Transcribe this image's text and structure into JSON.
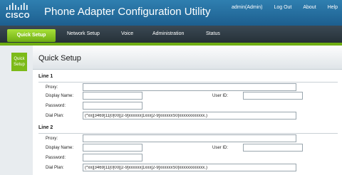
{
  "header": {
    "logo_text": "CISCO",
    "app_title": "Phone Adapter Configuration Utility",
    "links": [
      "admin(Admin)",
      "Log Out",
      "About",
      "Help"
    ]
  },
  "nav": {
    "tabs": [
      "Quick Setup",
      "Network Setup",
      "Voice",
      "Administration",
      "Status"
    ],
    "active": "Quick Setup"
  },
  "sidebar": {
    "items": [
      "Quick Setup"
    ]
  },
  "page": {
    "title": "Quick Setup"
  },
  "lines": [
    {
      "header": "Line 1",
      "proxy_label": "Proxy:",
      "proxy_value": "",
      "display_name_label": "Display Name:",
      "display_name_value": "",
      "user_id_label": "User ID:",
      "user_id_value": "",
      "password_label": "Password:",
      "password_value": "",
      "dial_plan_label": "Dial Plan:",
      "dial_plan_value": "(*xx|[3469]11|0|00|[2-9]xxxxxx|1xxx[2-9]xxxxxxS0|xxxxxxxxxxxx.)"
    },
    {
      "header": "Line 2",
      "proxy_label": "Proxy:",
      "proxy_value": "",
      "display_name_label": "Display Name:",
      "display_name_value": "",
      "user_id_label": "User ID:",
      "user_id_value": "",
      "password_label": "Password:",
      "password_value": "",
      "dial_plan_label": "Dial Plan:",
      "dial_plan_value": "(*xx|[3469]11|0|00|[2-9]xxxxxx|1xxx[2-9]xxxxxxS0|xxxxxxxxxxxx.)"
    }
  ],
  "colors": {
    "header": "#2f7fb0",
    "accent_green": "#7cba18",
    "nav": "#2b3740"
  }
}
